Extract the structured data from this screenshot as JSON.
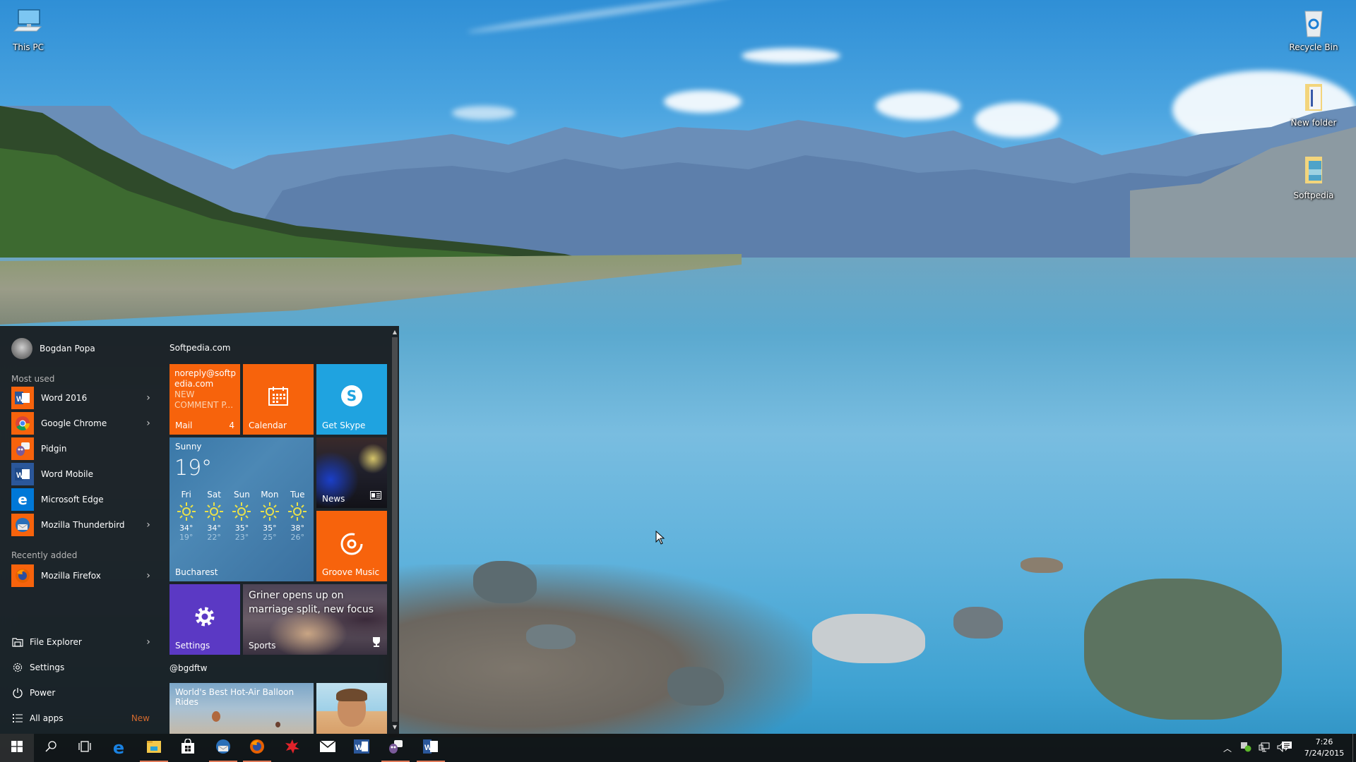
{
  "desktop": {
    "icons": [
      {
        "label": "This PC",
        "icon": "computer-icon"
      },
      {
        "label": "Recycle Bin",
        "icon": "recycle-bin-icon"
      },
      {
        "label": "New folder",
        "icon": "folder-icon"
      },
      {
        "label": "Softpedia",
        "icon": "folder-icon"
      }
    ]
  },
  "start_menu": {
    "user": {
      "name": "Bogdan Popa",
      "icon": "avatar"
    },
    "most_used_label": "Most used",
    "most_used": [
      {
        "label": "Word 2016",
        "icon": "word-icon",
        "has_submenu": true,
        "icon_bg": "#f7630c"
      },
      {
        "label": "Google Chrome",
        "icon": "chrome-icon",
        "has_submenu": true,
        "icon_bg": "#f7630c"
      },
      {
        "label": "Pidgin",
        "icon": "pidgin-icon",
        "has_submenu": false,
        "icon_bg": "#f7630c"
      },
      {
        "label": "Word Mobile",
        "icon": "word-icon",
        "has_submenu": false,
        "icon_bg": "#2b579a"
      },
      {
        "label": "Microsoft Edge",
        "icon": "edge-icon",
        "has_submenu": false,
        "icon_bg": "#0078d7"
      },
      {
        "label": "Mozilla Thunderbird",
        "icon": "thunderbird-icon",
        "has_submenu": true,
        "icon_bg": "#f7630c"
      }
    ],
    "recently_added_label": "Recently added",
    "recently_added": [
      {
        "label": "Mozilla Firefox",
        "icon": "firefox-icon",
        "has_submenu": true,
        "icon_bg": "#f7630c"
      }
    ],
    "system": [
      {
        "label": "File Explorer",
        "icon": "file-explorer-icon",
        "has_submenu": true
      },
      {
        "label": "Settings",
        "icon": "gear-icon",
        "has_submenu": false
      },
      {
        "label": "Power",
        "icon": "power-icon",
        "has_submenu": false
      },
      {
        "label": "All apps",
        "icon": "list-icon",
        "badge": "New"
      }
    ],
    "tile_groups": [
      {
        "label": "Softpedia.com"
      },
      {
        "label": "@bgdftw"
      }
    ],
    "tiles": {
      "mail": {
        "label": "Mail",
        "from": "noreply@softpedia.com",
        "subject": "NEW COMMENT P...",
        "count": "4"
      },
      "calendar": {
        "label": "Calendar"
      },
      "skype": {
        "label": "Get Skype"
      },
      "weather": {
        "condition": "Sunny",
        "temperature": "19°",
        "city": "Bucharest",
        "forecast": [
          {
            "day": "Fri",
            "high": "34°",
            "low": "19°"
          },
          {
            "day": "Sat",
            "high": "34°",
            "low": "22°"
          },
          {
            "day": "Sun",
            "high": "35°",
            "low": "23°"
          },
          {
            "day": "Mon",
            "high": "35°",
            "low": "25°"
          },
          {
            "day": "Tue",
            "high": "38°",
            "low": "26°"
          }
        ]
      },
      "news": {
        "label": "News"
      },
      "groove": {
        "label": "Groove Music"
      },
      "settings": {
        "label": "Settings"
      },
      "sports": {
        "label": "Sports",
        "headline": "Griner opens up on marriage split, new focus"
      },
      "balloon": {
        "headline": "World's Best Hot-Air Balloon Rides"
      }
    }
  },
  "taskbar": {
    "items": [
      {
        "name": "start-button",
        "icon": "windows-logo-icon",
        "running": false
      },
      {
        "name": "search-button",
        "icon": "search-icon",
        "running": false
      },
      {
        "name": "task-view-button",
        "icon": "task-view-icon",
        "running": false
      },
      {
        "name": "edge-button",
        "icon": "edge-icon",
        "running": false
      },
      {
        "name": "file-explorer-button",
        "icon": "file-explorer-icon",
        "running": true
      },
      {
        "name": "store-button",
        "icon": "store-icon",
        "running": false
      },
      {
        "name": "thunderbird-button",
        "icon": "thunderbird-icon",
        "running": true
      },
      {
        "name": "firefox-button",
        "icon": "firefox-icon",
        "running": true
      },
      {
        "name": "softpedia-button",
        "icon": "softpedia-icon",
        "running": false
      },
      {
        "name": "mail-button",
        "icon": "mail-icon",
        "running": false
      },
      {
        "name": "word-button",
        "icon": "word-icon",
        "running": false
      },
      {
        "name": "pidgin-button",
        "icon": "pidgin-icon",
        "running": true
      },
      {
        "name": "word-mobile-button",
        "icon": "word-icon",
        "running": true
      }
    ],
    "tray": {
      "time": "7:26",
      "date": "7/24/2015"
    }
  }
}
